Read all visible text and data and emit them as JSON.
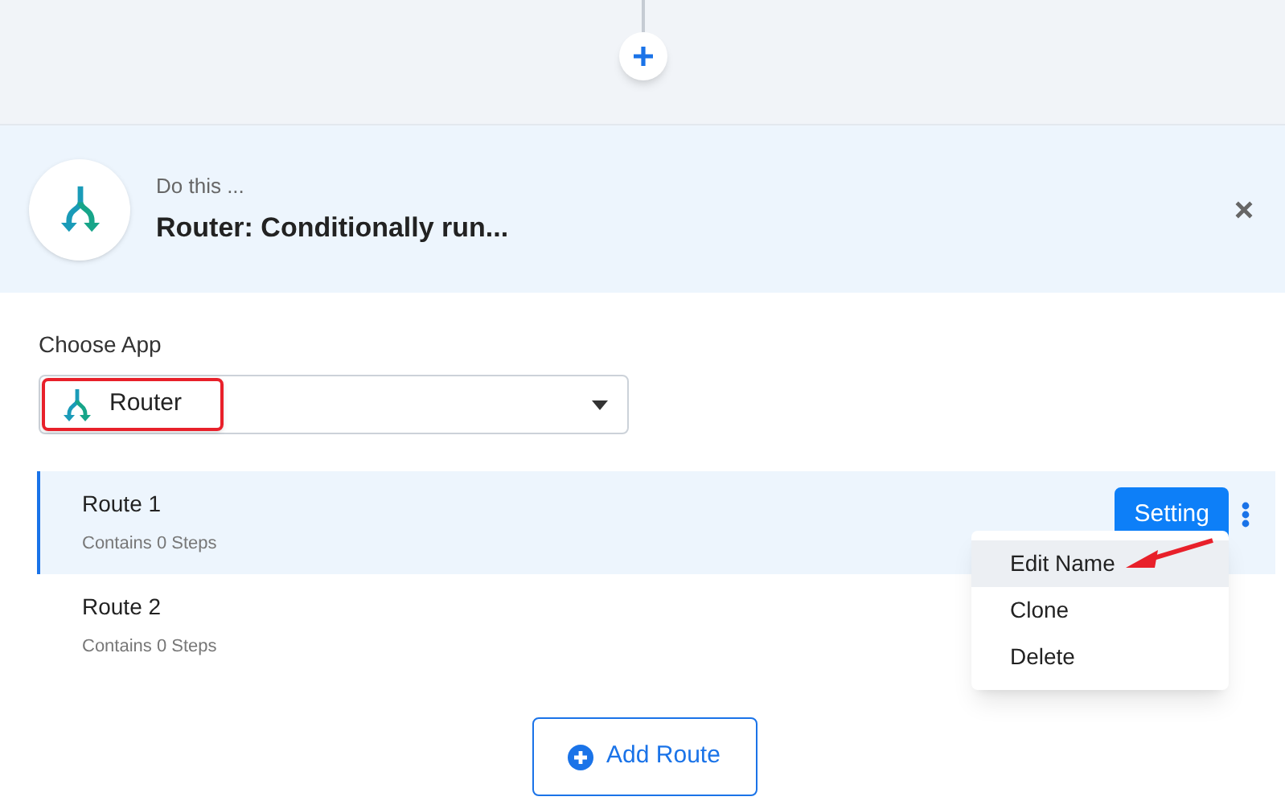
{
  "step_header": {
    "caption": "Do this ...",
    "title": "Router: Conditionally run..."
  },
  "choose_app": {
    "label": "Choose App",
    "value": "Router"
  },
  "routes": [
    {
      "name": "Route 1",
      "steps": "Contains 0 Steps",
      "selected": true,
      "button": "Setting"
    },
    {
      "name": "Route 2",
      "steps": "Contains 0 Steps",
      "selected": false
    }
  ],
  "route_menu": [
    {
      "label": "Edit Name",
      "selected": true
    },
    {
      "label": "Clone",
      "selected": false
    },
    {
      "label": "Delete",
      "selected": false
    }
  ],
  "add_button": "Add Route"
}
